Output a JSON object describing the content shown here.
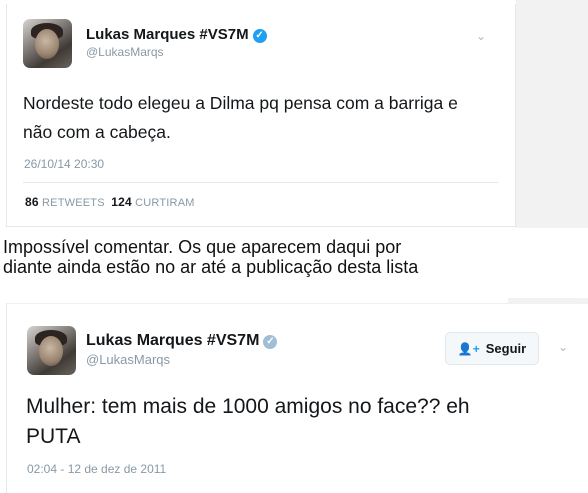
{
  "colors": {
    "verified_badge": "#1da1f2",
    "handle_gray": "#8899a6",
    "text": "#14171a",
    "border": "#e1e8ed"
  },
  "tweet1": {
    "display_name": "Lukas Marques #VS7M",
    "handle": "@LukasMarqs",
    "text_line1": "Nordeste todo elegeu a Dilma pq pensa com a barriga e",
    "text_line2": "não com a cabeça.",
    "timestamp": "26/10/14 20:30",
    "retweets_count": "86",
    "retweets_label": "RETWEETS",
    "likes_count": "124",
    "likes_label": "CURTIRAM",
    "icons": [
      "verified-badge-icon",
      "chevron-down-icon"
    ]
  },
  "caption": {
    "line1": "Impossível comentar. Os que aparecem daqui por",
    "line2": "diante ainda estão no ar até a publicação desta lista"
  },
  "tweet2": {
    "display_name": "Lukas Marques #VS7M",
    "handle": "@LukasMarqs",
    "follow_label": "Seguir",
    "text_line1": "Mulher: tem mais de 1000 amigos no face?? eh",
    "text_line2": "PUTA",
    "timestamp": "02:04 - 12 de dez de 2011",
    "icons": [
      "verified-badge-icon",
      "add-user-icon",
      "chevron-down-icon"
    ]
  }
}
